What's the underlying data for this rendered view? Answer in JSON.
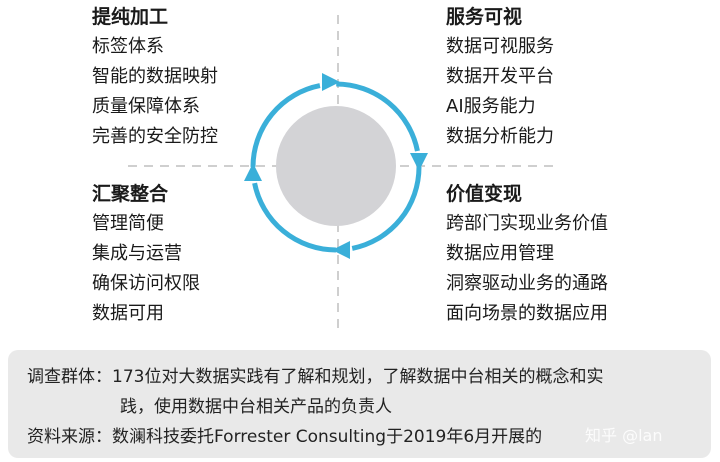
{
  "quadrants": {
    "top_left": {
      "title": "提纯加工",
      "items": [
        "标签体系",
        "智能的数据映射",
        "质量保障体系",
        "完善的安全防控"
      ]
    },
    "top_right": {
      "title": "服务可视",
      "items": [
        "数据可视服务",
        "数据开发平台",
        "AI服务能力",
        "数据分析能力"
      ]
    },
    "bottom_left": {
      "title": "汇聚整合",
      "items": [
        "管理简便",
        "集成与运营",
        "确保访问权限",
        "数据可用"
      ]
    },
    "bottom_right": {
      "title": "价值变现",
      "items": [
        "跨部门实现业务价值",
        "数据应用管理",
        "洞察驱动业务的通路",
        "面向场景的数据应用"
      ]
    }
  },
  "notes": {
    "survey_line1": "调查群体：173位对大数据实践有了解和规划，了解数据中台相关的概念和实",
    "survey_line2": "践，使用数据中台相关产品的负责人",
    "source": "资料来源：数澜科技委托Forrester Consulting于2019年6月开展的"
  },
  "watermark": "知乎 @lan",
  "colors": {
    "cycle": "#3aafd9",
    "center": "#d3d3d6",
    "divider": "#cfcfcf",
    "note_bg": "#e9e9e9"
  }
}
